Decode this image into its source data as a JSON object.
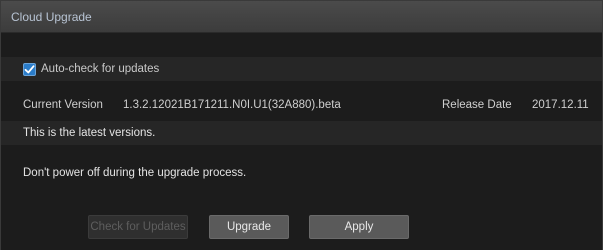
{
  "window": {
    "title": "Cloud Upgrade"
  },
  "auto_check": {
    "label": "Auto-check for updates",
    "checked": true
  },
  "version": {
    "current_label": "Current Version",
    "current_value": "1.3.2.12021B171211.N0I.U1(32A880).beta",
    "release_label": "Release Date",
    "release_value": "2017.12.11"
  },
  "status": {
    "message": "This is the latest versions."
  },
  "warning": {
    "message": "Don't power off during the upgrade process."
  },
  "buttons": {
    "check": "Check for Updates",
    "upgrade": "Upgrade",
    "apply": "Apply"
  },
  "colors": {
    "accent": "#2a7cc9",
    "title_text": "#b8c4d4"
  }
}
